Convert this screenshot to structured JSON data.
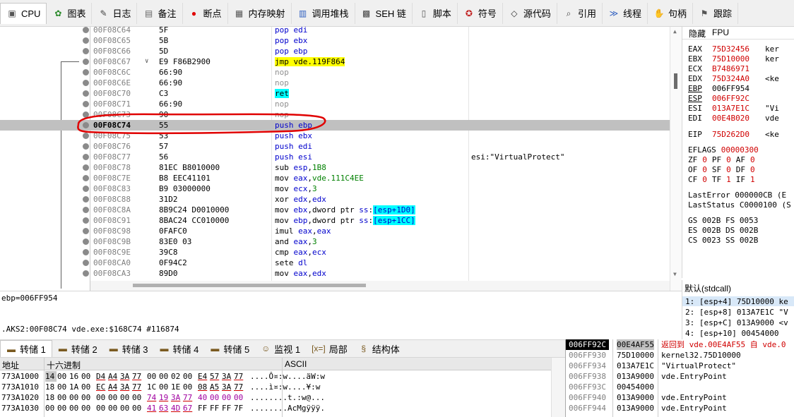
{
  "toolbar": {
    "tabs": [
      {
        "label": "CPU",
        "icon": "cpu-icon",
        "glyph": "▣",
        "color": "#555555"
      },
      {
        "label": "图表",
        "icon": "graph-icon",
        "glyph": "✿",
        "color": "#2a8a2a"
      },
      {
        "label": "日志",
        "icon": "log-icon",
        "glyph": "✎",
        "color": "#444444"
      },
      {
        "label": "备注",
        "icon": "notes-icon",
        "glyph": "▤",
        "color": "#666666"
      },
      {
        "label": "断点",
        "icon": "breakpoint-icon",
        "glyph": "●",
        "color": "#e00000"
      },
      {
        "label": "内存映射",
        "icon": "memory-map-icon",
        "glyph": "▦",
        "color": "#555555"
      },
      {
        "label": "调用堆栈",
        "icon": "call-stack-icon",
        "glyph": "▥",
        "color": "#3060c0"
      },
      {
        "label": "SEH 链",
        "icon": "seh-chain-icon",
        "glyph": "▩",
        "color": "#444444"
      },
      {
        "label": "脚本",
        "icon": "script-icon",
        "glyph": "▯",
        "color": "#555555"
      },
      {
        "label": "符号",
        "icon": "symbols-icon",
        "glyph": "✪",
        "color": "#c02020"
      },
      {
        "label": "源代码",
        "icon": "source-icon",
        "glyph": "◇",
        "color": "#333333"
      },
      {
        "label": "引用",
        "icon": "references-icon",
        "glyph": "⌕",
        "color": "#444444"
      },
      {
        "label": "线程",
        "icon": "threads-icon",
        "glyph": "≫",
        "color": "#3060c0"
      },
      {
        "label": "句柄",
        "icon": "handles-icon",
        "glyph": "✋",
        "color": "#c02020"
      },
      {
        "label": "跟踪",
        "icon": "trace-icon",
        "glyph": "⚑",
        "color": "#555555"
      }
    ]
  },
  "disasm": {
    "rows": [
      {
        "addr": "00F08C64",
        "bytes": "5F",
        "asm": [
          {
            "t": "pop edi",
            "c": "c-mn-blue"
          }
        ],
        "comment": ""
      },
      {
        "addr": "00F08C65",
        "bytes": "5B",
        "asm": [
          {
            "t": "pop ebx",
            "c": "c-mn-blue"
          }
        ],
        "comment": ""
      },
      {
        "addr": "00F08C66",
        "bytes": "5D",
        "asm": [
          {
            "t": "pop ebp",
            "c": "c-mn-blue"
          }
        ],
        "comment": ""
      },
      {
        "addr": "00F08C67",
        "bytes": "E9 F86B2900",
        "mark": "∨",
        "asm": [
          {
            "t": "jmp vde.119F864",
            "c": "jmp-hl"
          }
        ],
        "comment": ""
      },
      {
        "addr": "00F08C6C",
        "bytes": "66:90",
        "asm": [
          {
            "t": "nop",
            "c": "c-gray"
          }
        ],
        "comment": ""
      },
      {
        "addr": "00F08C6E",
        "bytes": "66:90",
        "asm": [
          {
            "t": "nop",
            "c": "c-gray"
          }
        ],
        "comment": ""
      },
      {
        "addr": "00F08C70",
        "bytes": "C3",
        "asm": [
          {
            "t": "ret",
            "c": "ret-hl"
          }
        ],
        "comment": ""
      },
      {
        "addr": "00F08C71",
        "bytes": "66:90",
        "asm": [
          {
            "t": "nop",
            "c": "c-gray"
          }
        ],
        "comment": ""
      },
      {
        "addr": "00F08C73",
        "bytes": "90",
        "asm": [
          {
            "t": "nop",
            "c": "c-gray"
          }
        ],
        "comment": ""
      },
      {
        "addr": "00F08C74",
        "bytes": "55",
        "asm": [
          {
            "t": "push ebp",
            "c": "c-mn-blue"
          }
        ],
        "comment": "",
        "selected": true
      },
      {
        "addr": "00F08C75",
        "bytes": "53",
        "asm": [
          {
            "t": "push ebx",
            "c": "c-mn-blue"
          }
        ],
        "comment": ""
      },
      {
        "addr": "00F08C76",
        "bytes": "57",
        "asm": [
          {
            "t": "push edi",
            "c": "c-mn-blue"
          }
        ],
        "comment": ""
      },
      {
        "addr": "00F08C77",
        "bytes": "56",
        "asm": [
          {
            "t": "push esi",
            "c": "c-mn-blue"
          }
        ],
        "comment": "esi:\"VirtualProtect\""
      },
      {
        "addr": "00F08C78",
        "bytes": "81EC B8010000",
        "asm": [
          {
            "t": "sub ",
            "c": ""
          },
          {
            "t": "esp",
            "c": "reg"
          },
          {
            "t": ",",
            "c": ""
          },
          {
            "t": "1B8",
            "c": "addr-ref"
          }
        ],
        "comment": ""
      },
      {
        "addr": "00F08C7E",
        "bytes": "B8 EEC41101",
        "asm": [
          {
            "t": "mov ",
            "c": ""
          },
          {
            "t": "eax",
            "c": "reg"
          },
          {
            "t": ",",
            "c": ""
          },
          {
            "t": "vde.111C4EE",
            "c": "addr-ref"
          }
        ],
        "comment": ""
      },
      {
        "addr": "00F08C83",
        "bytes": "B9 03000000",
        "asm": [
          {
            "t": "mov ",
            "c": ""
          },
          {
            "t": "ecx",
            "c": "reg"
          },
          {
            "t": ",",
            "c": ""
          },
          {
            "t": "3",
            "c": "addr-ref"
          }
        ],
        "comment": ""
      },
      {
        "addr": "00F08C88",
        "bytes": "31D2",
        "asm": [
          {
            "t": "xor ",
            "c": ""
          },
          {
            "t": "edx",
            "c": "reg"
          },
          {
            "t": ",",
            "c": ""
          },
          {
            "t": "edx",
            "c": "reg"
          }
        ],
        "comment": ""
      },
      {
        "addr": "00F08C8A",
        "bytes": "8B9C24 D0010000",
        "asm": [
          {
            "t": "mov ",
            "c": ""
          },
          {
            "t": "ebx",
            "c": "reg"
          },
          {
            "t": ",dword ptr ",
            "c": ""
          },
          {
            "t": "ss",
            "c": "reg"
          },
          {
            "t": ":",
            "c": ""
          },
          {
            "t": "[esp+1D0]",
            "c": "br"
          }
        ],
        "comment": ""
      },
      {
        "addr": "00F08C91",
        "bytes": "8BAC24 CC010000",
        "asm": [
          {
            "t": "mov ",
            "c": ""
          },
          {
            "t": "ebp",
            "c": "reg"
          },
          {
            "t": ",dword ptr ",
            "c": ""
          },
          {
            "t": "ss",
            "c": "reg"
          },
          {
            "t": ":",
            "c": ""
          },
          {
            "t": "[esp+1CC]",
            "c": "br"
          }
        ],
        "comment": ""
      },
      {
        "addr": "00F08C98",
        "bytes": "0FAFC0",
        "asm": [
          {
            "t": "imul ",
            "c": ""
          },
          {
            "t": "eax",
            "c": "reg"
          },
          {
            "t": ",",
            "c": ""
          },
          {
            "t": "eax",
            "c": "reg"
          }
        ],
        "comment": ""
      },
      {
        "addr": "00F08C9B",
        "bytes": "83E0 03",
        "asm": [
          {
            "t": "and ",
            "c": ""
          },
          {
            "t": "eax",
            "c": "reg"
          },
          {
            "t": ",",
            "c": ""
          },
          {
            "t": "3",
            "c": "addr-ref"
          }
        ],
        "comment": ""
      },
      {
        "addr": "00F08C9E",
        "bytes": "39C8",
        "asm": [
          {
            "t": "cmp ",
            "c": ""
          },
          {
            "t": "eax",
            "c": "reg"
          },
          {
            "t": ",",
            "c": ""
          },
          {
            "t": "ecx",
            "c": "reg"
          }
        ],
        "comment": ""
      },
      {
        "addr": "00F08CA0",
        "bytes": "0F94C2",
        "asm": [
          {
            "t": "sete ",
            "c": ""
          },
          {
            "t": "dl",
            "c": "reg"
          }
        ],
        "comment": ""
      },
      {
        "addr": "00F08CA3",
        "bytes": "89D0",
        "asm": [
          {
            "t": "mov ",
            "c": ""
          },
          {
            "t": "eax",
            "c": "reg"
          },
          {
            "t": ",",
            "c": ""
          },
          {
            "t": "edx",
            "c": "reg"
          }
        ],
        "comment": ""
      }
    ]
  },
  "info": {
    "line1": "ebp=006FF954",
    "line2": ".AKS2:00F08C74 vde.exe:$168C74 #116874"
  },
  "registers": {
    "tab_hide": "隐藏",
    "tab_fpu": "FPU",
    "gpr": [
      {
        "name": "EAX",
        "value": "75D32456",
        "comment": "ker",
        "ul": false
      },
      {
        "name": "EBX",
        "value": "75D10000",
        "comment": "ker",
        "ul": false
      },
      {
        "name": "ECX",
        "value": "B7486971",
        "comment": "",
        "ul": false
      },
      {
        "name": "EDX",
        "value": "75D324A0",
        "comment": "<ke",
        "ul": false
      },
      {
        "name": "EBP",
        "value": "006FF954",
        "comment": "",
        "ul": true,
        "black": true
      },
      {
        "name": "ESP",
        "value": "006FF92C",
        "comment": "",
        "ul": true
      },
      {
        "name": "ESI",
        "value": "013A7E1C",
        "comment": "\"Vi",
        "ul": false
      },
      {
        "name": "EDI",
        "value": "00E4B020",
        "comment": "vde",
        "ul": false
      }
    ],
    "eip": {
      "name": "EIP",
      "value": "75D262D0",
      "comment": "<ke"
    },
    "eflags": {
      "name": "EFLAGS",
      "value": "00000300"
    },
    "flags": [
      [
        {
          "n": "ZF",
          "v": "0"
        },
        {
          "n": "PF",
          "v": "0"
        },
        {
          "n": "AF",
          "v": "0"
        }
      ],
      [
        {
          "n": "OF",
          "v": "0"
        },
        {
          "n": "SF",
          "v": "0"
        },
        {
          "n": "DF",
          "v": "0"
        }
      ],
      [
        {
          "n": "CF",
          "v": "0"
        },
        {
          "n": "TF",
          "v": "1"
        },
        {
          "n": "IF",
          "v": "1"
        }
      ]
    ],
    "last_error": "LastError  000000CB (E",
    "last_status": "LastStatus C0000100 (S",
    "segs": [
      "GS 002B  FS 0053",
      "ES 002B  DS 002B",
      "CS 0023  SS 002B"
    ]
  },
  "callconv": {
    "title": "默认(stdcall)",
    "rows": [
      "1: [esp+4] 75D10000 ke",
      "2: [esp+8] 013A7E1C \"V",
      "3: [esp+C] 013A9000 <v",
      "4: [esp+10] 00454000"
    ]
  },
  "bottom_tabs": [
    {
      "label": "转储 1",
      "icon": "dump-icon",
      "glyph": "▬"
    },
    {
      "label": "转储 2",
      "icon": "dump-icon",
      "glyph": "▬"
    },
    {
      "label": "转储 3",
      "icon": "dump-icon",
      "glyph": "▬"
    },
    {
      "label": "转储 4",
      "icon": "dump-icon",
      "glyph": "▬"
    },
    {
      "label": "转储 5",
      "icon": "dump-icon",
      "glyph": "▬"
    },
    {
      "label": "监视 1",
      "icon": "watch-icon",
      "glyph": "☺"
    },
    {
      "label": "局部",
      "icon": "locals-icon",
      "glyph": "[x=]"
    },
    {
      "label": "结构体",
      "icon": "struct-icon",
      "glyph": "§"
    }
  ],
  "dump": {
    "headers": {
      "addr": "地址",
      "hex": "十六进制",
      "ascii": "ASCII"
    },
    "rows": [
      {
        "addr": "773A1000",
        "hex": [
          "14",
          "00",
          "16",
          "00",
          "D4",
          "A4",
          "3A",
          "77",
          "00",
          "00",
          "02",
          "00",
          "E4",
          "57",
          "3A",
          "77"
        ],
        "ascii": "....Ô¤:w....äW:w"
      },
      {
        "addr": "773A1010",
        "hex": [
          "18",
          "00",
          "1A",
          "00",
          "EC",
          "A4",
          "3A",
          "77",
          "1C",
          "00",
          "1E",
          "00",
          "08",
          "A5",
          "3A",
          "77"
        ],
        "ascii": "....ì¤:w....¥:w"
      },
      {
        "addr": "773A1020",
        "hex": [
          "18",
          "00",
          "00",
          "00",
          "00",
          "00",
          "00",
          "00",
          "74",
          "19",
          "3A",
          "77",
          "40",
          "00",
          "00",
          "00"
        ],
        "ascii": "........t.:w@..."
      },
      {
        "addr": "773A1030",
        "hex": [
          "00",
          "00",
          "00",
          "00",
          "00",
          "00",
          "00",
          "00",
          "41",
          "63",
          "4D",
          "67",
          "FF",
          "FF",
          "FF",
          "7F"
        ],
        "ascii": "........AcMgÿÿÿ."
      }
    ]
  },
  "stack": {
    "rows": [
      {
        "addr": "006FF92C",
        "val": "00E4AF55",
        "cmt": "返回到 vde.00E4AF55 自 vde.0",
        "sel": true
      },
      {
        "addr": "006FF930",
        "val": "75D10000",
        "cmt": "kernel32.75D10000"
      },
      {
        "addr": "006FF934",
        "val": "013A7E1C",
        "cmt": "\"VirtualProtect\""
      },
      {
        "addr": "006FF938",
        "val": "013A9000",
        "cmt": "vde.EntryPoint"
      },
      {
        "addr": "006FF93C",
        "val": "00454000",
        "cmt": ""
      },
      {
        "addr": "006FF940",
        "val": "013A9000",
        "cmt": "vde.EntryPoint"
      },
      {
        "addr": "006FF944",
        "val": "013A9000",
        "cmt": "vde.EntryPoint"
      }
    ]
  }
}
